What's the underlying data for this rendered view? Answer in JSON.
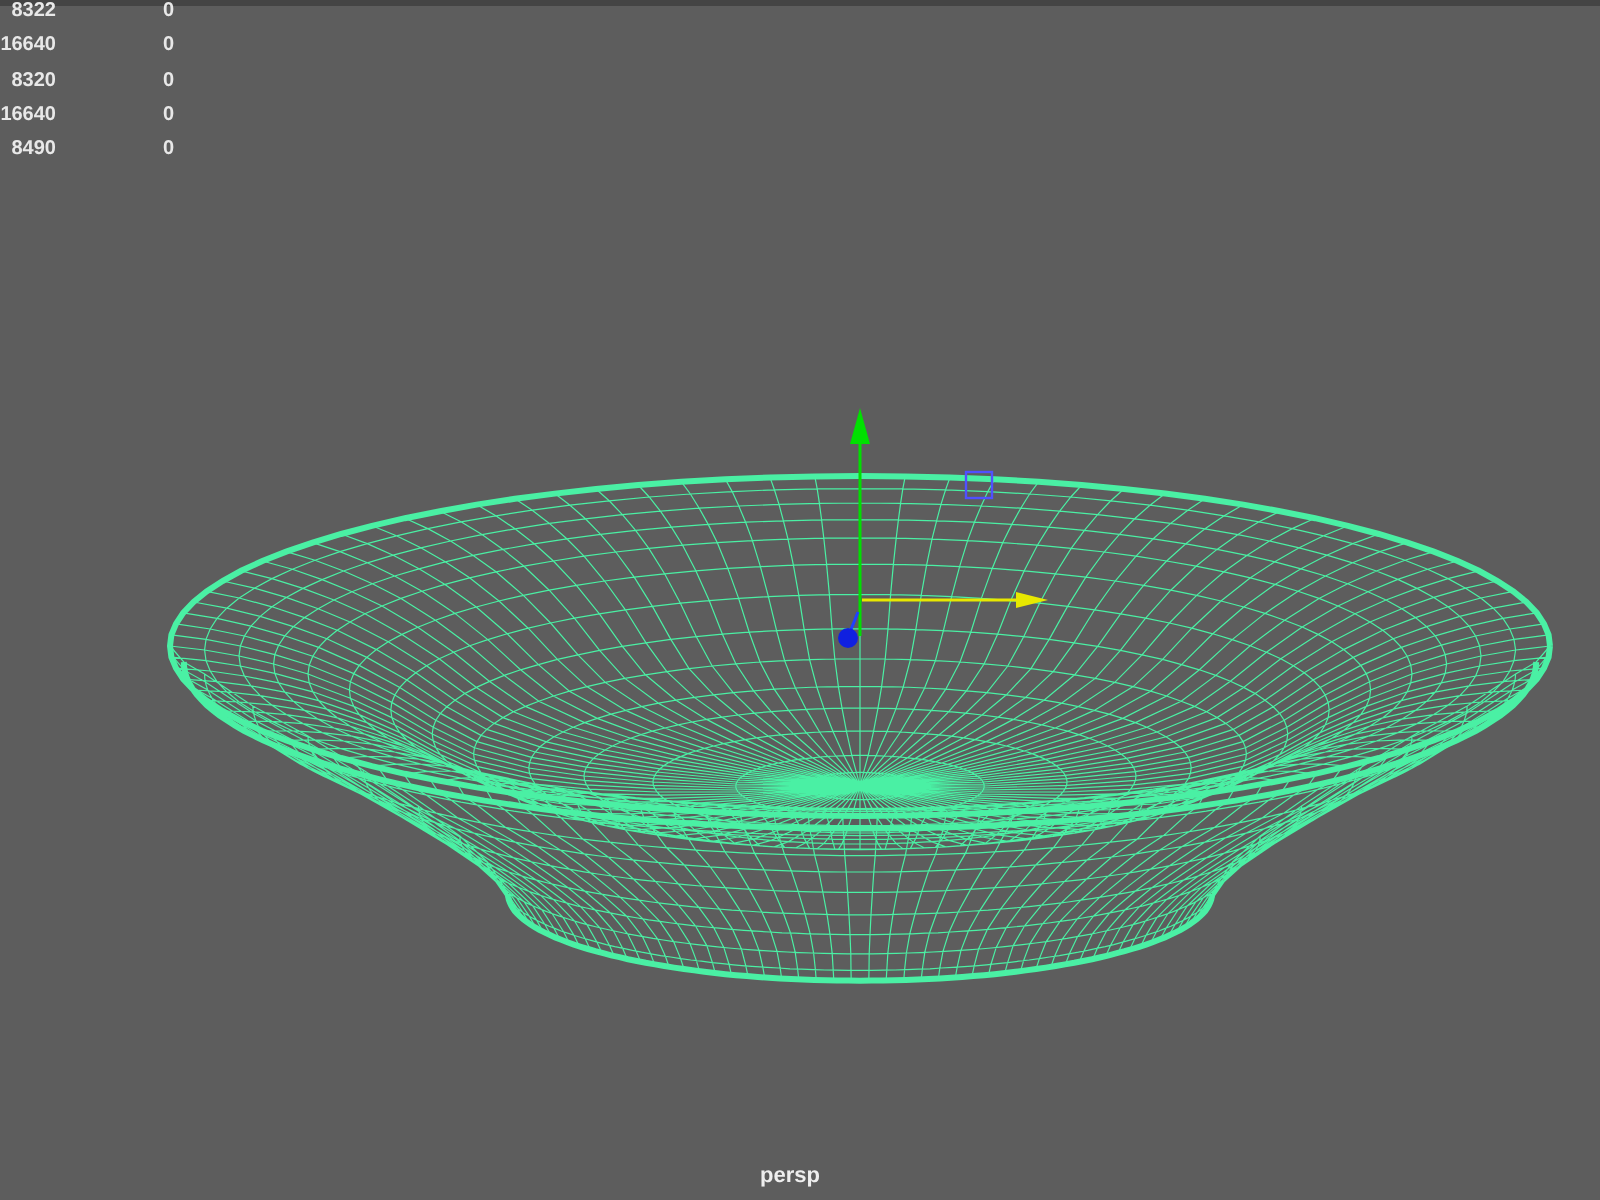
{
  "hud_stats": [
    {
      "value": "8322",
      "column_2": "0"
    },
    {
      "value": "16640",
      "column_2": "0"
    },
    {
      "value": "8320",
      "column_2": "0"
    },
    {
      "value": "16640",
      "column_2": "0"
    },
    {
      "value": "8490",
      "column_2": "0"
    }
  ],
  "camera_label": "persp"
}
